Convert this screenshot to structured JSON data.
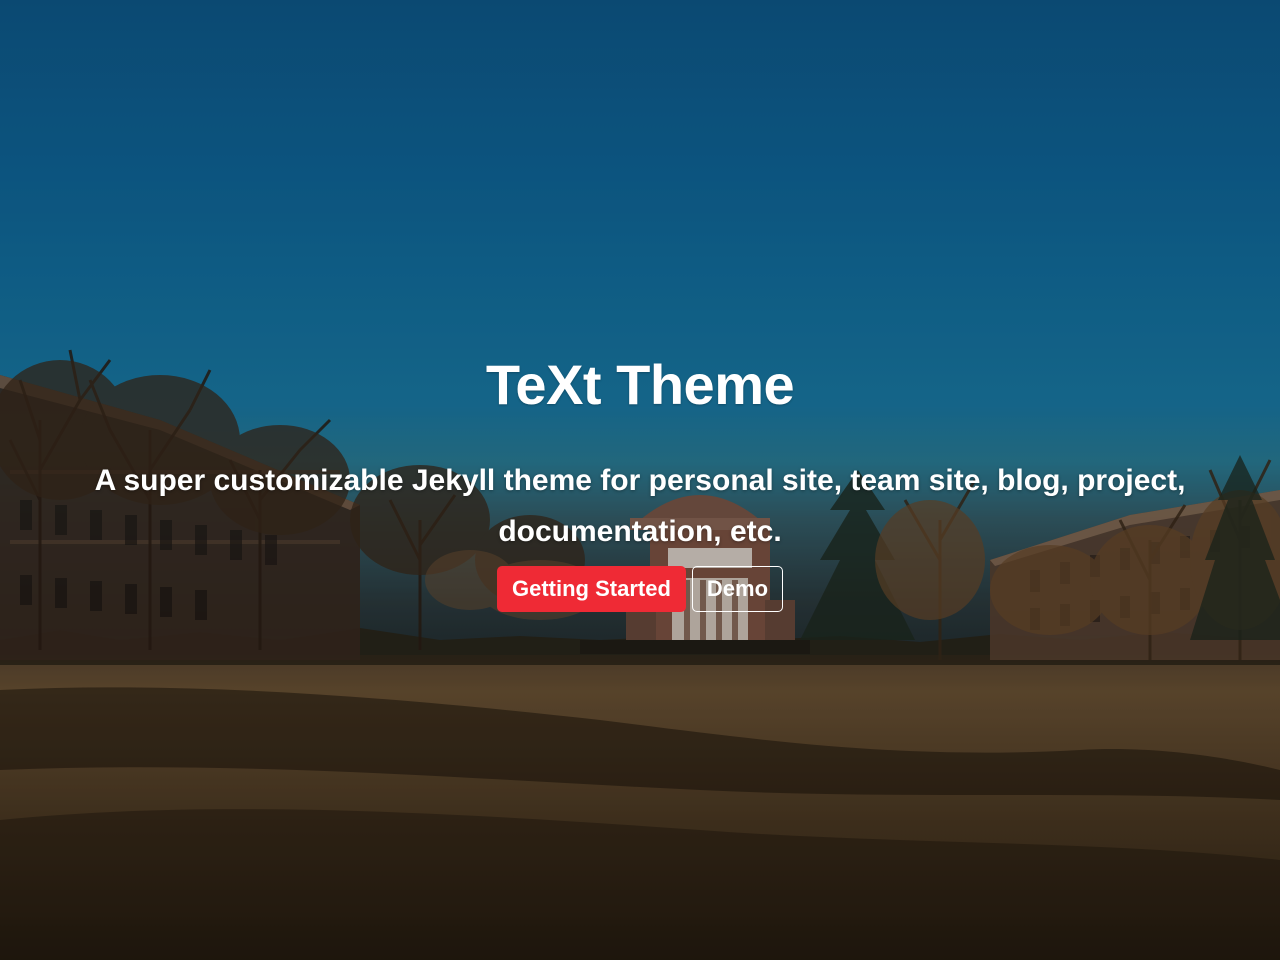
{
  "hero": {
    "title": "TeXt Theme",
    "subtitle": "A super customizable Jekyll theme for personal site, team site, blog, project, documentation, etc.",
    "primary_button_label": "Getting Started",
    "secondary_button_label": "Demo"
  },
  "colors": {
    "primary_button": "#ef2a35",
    "text": "#ffffff",
    "sky": "#0f679b",
    "ground": "#5a4630"
  }
}
